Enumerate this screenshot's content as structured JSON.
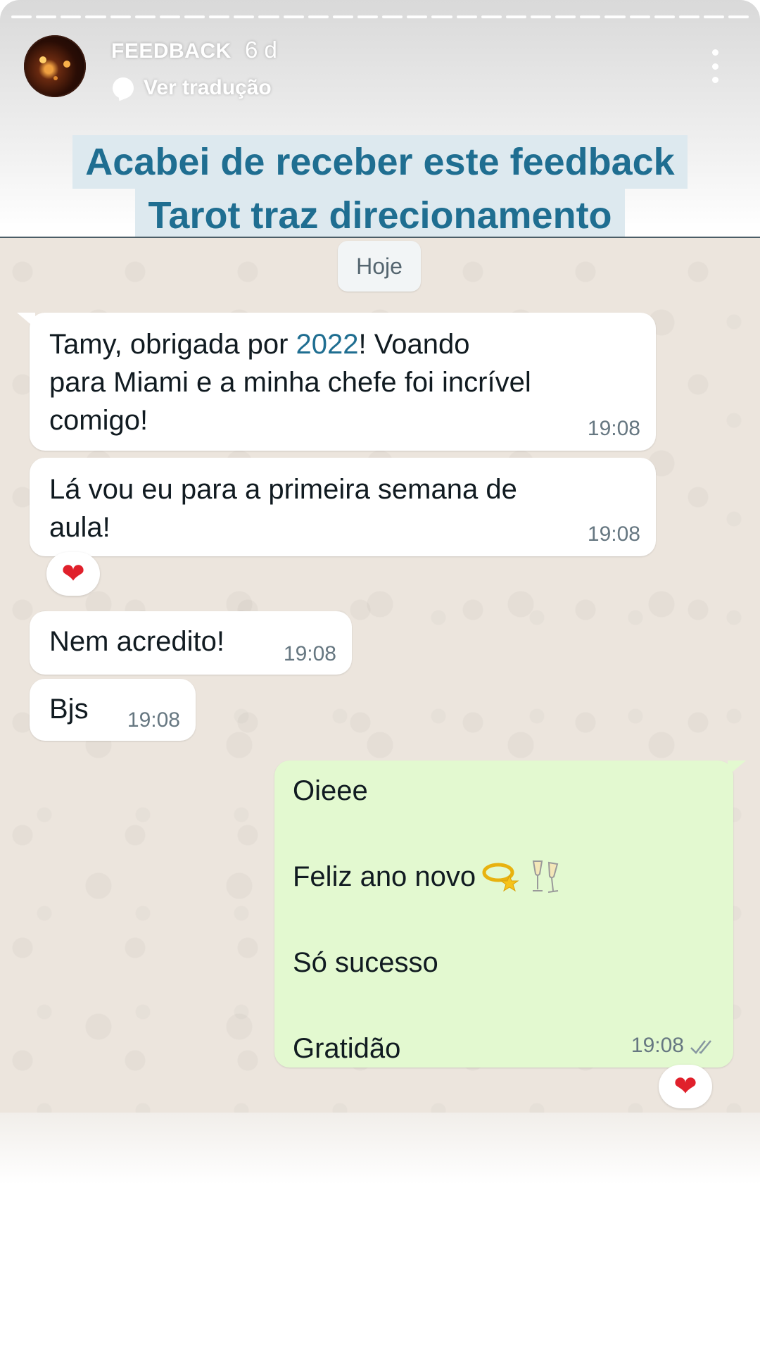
{
  "story": {
    "user_name": "FEEDBACK",
    "post_time": "6 d",
    "translate_label": "Ver tradução",
    "caption_line1": "Acabei de receber este feedback",
    "caption_line2": "Tarot traz direcionamento"
  },
  "chat": {
    "date_chip": "Hoje",
    "messages_in": [
      {
        "text_a": "Tamy, obrigada por ",
        "highlight": "2022",
        "text_b": "! Voando",
        "line2": "para Miami e a minha chefe foi incrível",
        "line3": "comigo!",
        "time": "19:08"
      },
      {
        "line1": "Lá vou eu para a primeira semana de",
        "line2": "aula!",
        "time": "19:08"
      },
      {
        "text": "Nem acredito!",
        "time": "19:08"
      },
      {
        "text": "Bjs",
        "time": "19:08"
      }
    ],
    "reaction_1": "❤",
    "message_out": {
      "line1": "Oieee",
      "line2": "Feliz ano novo",
      "line3": "Só sucesso",
      "line4": "Gratidão",
      "time": "19:08",
      "status_icon": "double-check"
    },
    "reaction_2": "❤"
  },
  "colors": {
    "caption_text": "#1f6e91",
    "caption_bg": "#dde9ef",
    "chat_bg": "#ece5dd",
    "outgoing_bubble": "#e3f9d0",
    "heart": "#e0202b"
  }
}
